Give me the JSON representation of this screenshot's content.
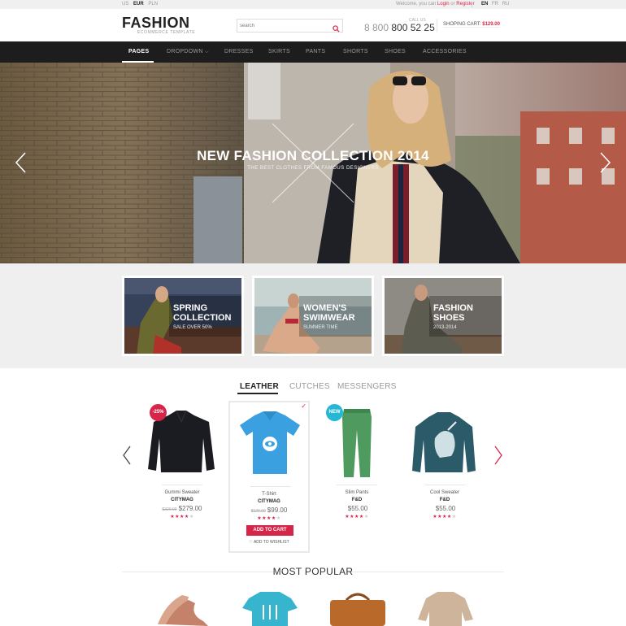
{
  "topbar": {
    "currencies": [
      {
        "label": "US",
        "active": false
      },
      {
        "label": "EUR",
        "active": true
      },
      {
        "label": "PLN",
        "active": false
      }
    ],
    "welcome_prefix": "Welcome, you can",
    "login_label": "Login",
    "or_text": "or",
    "register_label": "Register",
    "languages": [
      {
        "label": "EN",
        "active": true
      },
      {
        "label": "FR",
        "active": false
      },
      {
        "label": "RU",
        "active": false
      }
    ]
  },
  "header": {
    "logo": "FASHION",
    "logo_sub": "ECOMMERCE TEMPLATE",
    "search_placeholder": "search",
    "call_label": "CALL US",
    "phone_prefix": "8 800",
    "phone_number": "800 52 25",
    "cart_label": "SHOPING CART:",
    "cart_total": "$129.00"
  },
  "nav": {
    "items": [
      {
        "label": "PAGES",
        "active": true
      },
      {
        "label": "DROPDOWN",
        "active": false
      },
      {
        "label": "DRESSES",
        "active": false
      },
      {
        "label": "SKIRTS",
        "active": false
      },
      {
        "label": "PANTS",
        "active": false
      },
      {
        "label": "SHORTS",
        "active": false
      },
      {
        "label": "SHOES",
        "active": false
      },
      {
        "label": "ACCESSORIES",
        "active": false
      }
    ]
  },
  "hero": {
    "title": "NEW FASHION COLLECTION 2014",
    "subtitle": "THE BEST CLOTHES FROM FAMOUS DESIGNERS"
  },
  "banners": [
    {
      "title_line1": "SPRING",
      "title_line2": "COLLECTION",
      "subtitle": "SALE OVER 50%"
    },
    {
      "title_line1": "WOMEN'S",
      "title_line2": "SWIMWEAR",
      "subtitle": "SUMMER TIME"
    },
    {
      "title_line1": "FASHION",
      "title_line2": "SHOES",
      "subtitle": "2013-2014"
    }
  ],
  "tabs": [
    {
      "label": "LEATHER",
      "active": true
    },
    {
      "label": "CUTCHES",
      "active": false
    },
    {
      "label": "MESSENGERS",
      "active": false
    }
  ],
  "products": [
    {
      "name": "Gummi Sweater",
      "brand": "CITYMAG",
      "old_price": "$329.00",
      "price": "$279.00",
      "rating": 4,
      "badge": "-25%"
    },
    {
      "name": "T-Shirt",
      "brand": "CITYMAG",
      "old_price": "$129.00",
      "price": "$99.00",
      "rating": 4,
      "badge": ""
    },
    {
      "name": "Slim Pants",
      "brand": "F&D",
      "old_price": "",
      "price": "$55.00",
      "rating": 4,
      "badge": "NEW"
    },
    {
      "name": "Cool Sweater",
      "brand": "F&D",
      "old_price": "",
      "price": "$55.00",
      "rating": 4,
      "badge": ""
    }
  ],
  "product_actions": {
    "add_to_cart": "ADD TO CART",
    "add_to_wishlist": "ADD TO WISHLIST"
  },
  "most_popular": {
    "title": "MOST POPULAR"
  },
  "colors": {
    "accent": "#d7254a",
    "nav_bg": "#1d1d1d",
    "badge_new": "#27b7d6"
  }
}
